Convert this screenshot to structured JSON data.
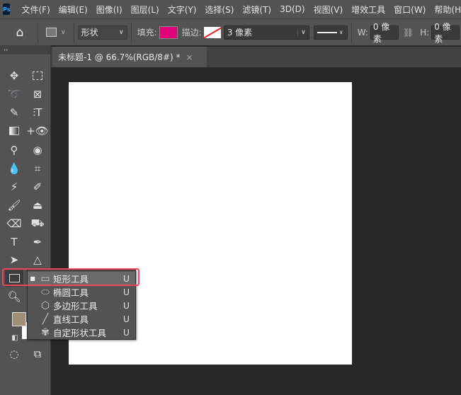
{
  "app": {
    "logo": "Ps"
  },
  "menu": [
    "文件(F)",
    "编辑(E)",
    "图像(I)",
    "图层(L)",
    "文字(Y)",
    "选择(S)",
    "滤镜(T)",
    "3D(D)",
    "视图(V)",
    "增效工具",
    "窗口(W)",
    "帮助(H)"
  ],
  "options": {
    "mode": "形状",
    "fill_label": "填充:",
    "fill_color": "#e0007a",
    "stroke_label": "描边:",
    "stroke_width": "3 像素",
    "w_label": "W:",
    "w_value": "0 像素",
    "h_label": "H:",
    "h_value": "0 像素"
  },
  "toolbar": {
    "collapse": "‹‹"
  },
  "document": {
    "tab_title": "未标题-1 @ 66.7%(RGB/8#) *",
    "close": "×"
  },
  "flyout": {
    "items": [
      {
        "label": "矩形工具",
        "key": "U",
        "icon": "rectangle-icon",
        "selected": true
      },
      {
        "label": "椭圆工具",
        "key": "U",
        "icon": "ellipse-icon"
      },
      {
        "label": "多边形工具",
        "key": "U",
        "icon": "polygon-icon"
      },
      {
        "label": "直线工具",
        "key": "U",
        "icon": "line-icon"
      },
      {
        "label": "自定形状工具",
        "key": "U",
        "icon": "custom-shape-icon"
      }
    ]
  },
  "colors": {
    "foreground": "#a08f77",
    "background": "#ffffff",
    "highlight": "#f0465e"
  }
}
